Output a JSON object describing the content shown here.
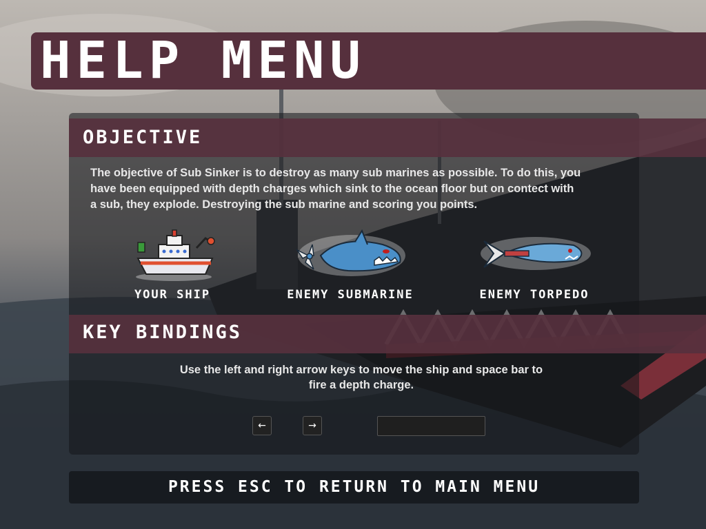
{
  "title": "HELP MENU",
  "objective": {
    "heading": "OBJECTIVE",
    "text_line1": "The objective of Sub Sinker is to destroy as many sub marines as possible. To do this, you",
    "text_line2": "have been equipped with depth charges which sink to the ocean floor but on contect with",
    "text_line3": "a sub, they explode. Destroying the sub marine and scoring you points."
  },
  "sprites": [
    {
      "label": "YOUR SHIP",
      "icon": "ship-icon"
    },
    {
      "label": "ENEMY SUBMARINE",
      "icon": "shark-submarine-icon"
    },
    {
      "label": "ENEMY TORPEDO",
      "icon": "fish-torpedo-icon"
    }
  ],
  "key_bindings": {
    "heading": "KEY BINDINGS",
    "text_line1": "Use the left and right arrow keys to move the ship and space bar to",
    "text_line2": "fire a depth charge.",
    "keys": [
      {
        "name": "left-arrow-key",
        "glyph": "←"
      },
      {
        "name": "right-arrow-key",
        "glyph": "→"
      },
      {
        "name": "space-bar-key",
        "glyph": ""
      }
    ]
  },
  "footer": "PRESS ESC TO RETURN TO MAIN MENU",
  "colors": {
    "accent": "#56303d",
    "panel": "#14161a",
    "text": "#ffffff"
  }
}
